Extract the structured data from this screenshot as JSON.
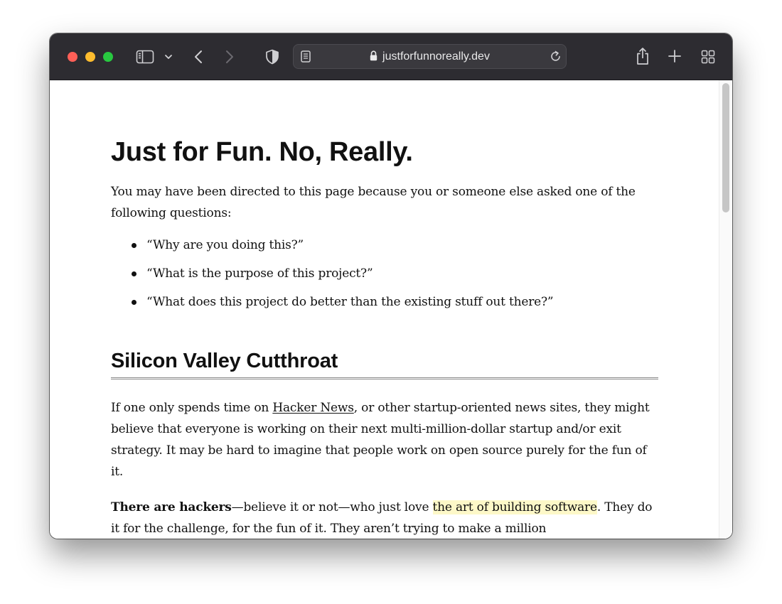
{
  "browser": {
    "url": "justforfunnoreally.dev",
    "colors": {
      "toolbar": "#2d2c31",
      "close": "#fe5f57",
      "minimize": "#febc2e",
      "zoom": "#28c840",
      "highlight": "#fdf8c8"
    }
  },
  "article": {
    "title": "Just for Fun. No, Really.",
    "intro": "You may have been directed to this page because you or someone else asked one of the following questions:",
    "questions": [
      "“Why are you doing this?”",
      "“What is the purpose of this project?”",
      "“What does this project do better than the existing stuff out there?”"
    ],
    "section_heading": "Silicon Valley Cutthroat",
    "para1": {
      "before": "If one only spends time on ",
      "link": "Hacker News",
      "after": ", or other startup-oriented news sites, they might believe that everyone is working on their next multi-million-dollar startup and/or exit strategy. It may be hard to imagine that people work on open source purely for the fun of it."
    },
    "para2": {
      "bold": "There are hackers",
      "middle": "—believe it or not—who just love ",
      "highlight": "the art of building software",
      "after": ". They do it for the challenge, for the fun of it. They aren’t trying to make a million"
    }
  }
}
